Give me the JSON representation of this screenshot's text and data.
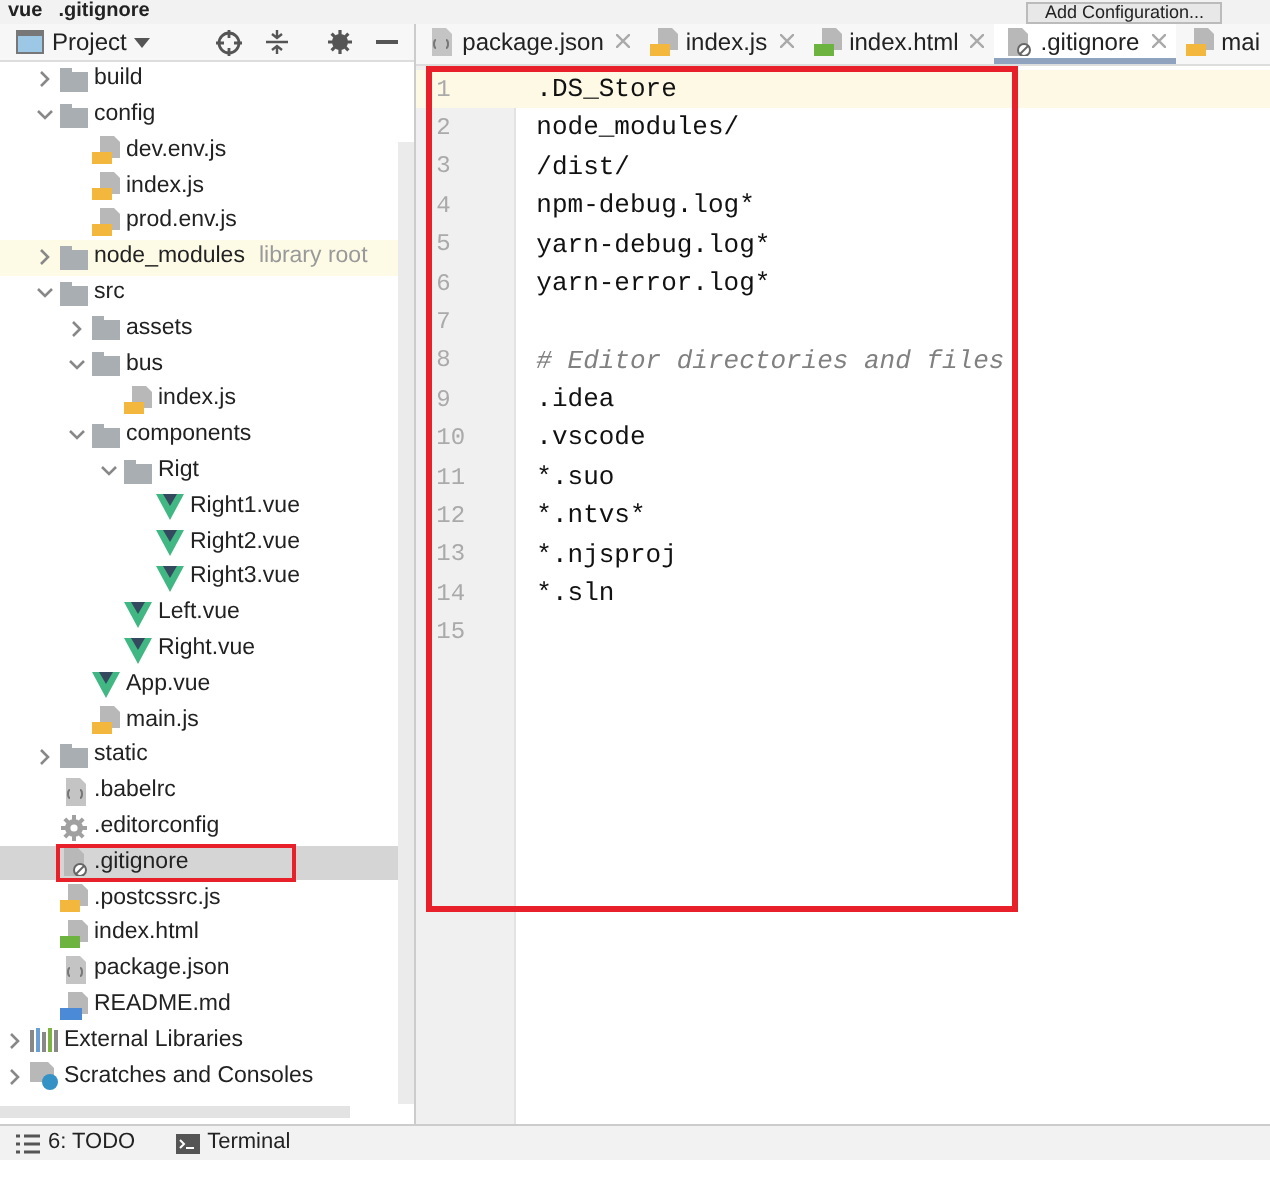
{
  "breadcrumb": [
    "vue",
    ".gitignore"
  ],
  "run_config": {
    "label": "Add Configuration..."
  },
  "project_panel": {
    "title": "Project"
  },
  "tree": [
    {
      "name": "build",
      "kind": "folder",
      "expanded": false,
      "selected": false,
      "highlighted": false
    },
    {
      "name": "config",
      "kind": "folder",
      "expanded": true,
      "selected": false,
      "highlighted": false,
      "children": [
        {
          "name": "dev.env.js",
          "kind": "js",
          "selected": false,
          "highlighted": false
        },
        {
          "name": "index.js",
          "kind": "js",
          "selected": false,
          "highlighted": false
        },
        {
          "name": "prod.env.js",
          "kind": "js",
          "selected": false,
          "highlighted": false
        }
      ]
    },
    {
      "name": "node_modules",
      "kind": "folder",
      "expanded": false,
      "selected": false,
      "highlighted": false,
      "hint": "library root"
    },
    {
      "name": "src",
      "kind": "folder",
      "expanded": true,
      "selected": false,
      "highlighted": false,
      "children": [
        {
          "name": "assets",
          "kind": "folder",
          "expanded": false,
          "selected": false,
          "highlighted": false
        },
        {
          "name": "bus",
          "kind": "folder",
          "expanded": true,
          "selected": false,
          "highlighted": false,
          "children": [
            {
              "name": "index.js",
              "kind": "js",
              "selected": false,
              "highlighted": false
            }
          ]
        },
        {
          "name": "components",
          "kind": "folder",
          "expanded": true,
          "selected": false,
          "highlighted": false,
          "children": [
            {
              "name": "Rigt",
              "kind": "folder",
              "expanded": true,
              "selected": false,
              "highlighted": false,
              "children": [
                {
                  "name": "Right1.vue",
                  "kind": "vue",
                  "selected": false,
                  "highlighted": false
                },
                {
                  "name": "Right2.vue",
                  "kind": "vue",
                  "selected": false,
                  "highlighted": false
                },
                {
                  "name": "Right3.vue",
                  "kind": "vue",
                  "selected": false,
                  "highlighted": false
                }
              ]
            },
            {
              "name": "Left.vue",
              "kind": "vue",
              "selected": false,
              "highlighted": false
            },
            {
              "name": "Right.vue",
              "kind": "vue",
              "selected": false,
              "highlighted": false
            }
          ]
        },
        {
          "name": "App.vue",
          "kind": "vue",
          "selected": false,
          "highlighted": false
        },
        {
          "name": "main.js",
          "kind": "js",
          "selected": false,
          "highlighted": false
        }
      ]
    },
    {
      "name": "static",
      "kind": "folder",
      "expanded": false,
      "selected": false,
      "highlighted": false
    },
    {
      "name": ".babelrc",
      "kind": "config",
      "selected": false,
      "highlighted": false
    },
    {
      "name": ".editorconfig",
      "kind": "settings",
      "selected": false,
      "highlighted": false
    },
    {
      "name": ".gitignore",
      "kind": "ignore",
      "selected": true,
      "highlighted": true
    },
    {
      "name": ".postcssrc.js",
      "kind": "js",
      "selected": false,
      "highlighted": false
    },
    {
      "name": "index.html",
      "kind": "html",
      "selected": false,
      "highlighted": false
    },
    {
      "name": "package.json",
      "kind": "config",
      "selected": false,
      "highlighted": false
    },
    {
      "name": "README.md",
      "kind": "md",
      "selected": false,
      "highlighted": false
    },
    {
      "name": "External Libraries",
      "kind": "libraries",
      "expanded": false,
      "selected": false,
      "highlighted": false
    },
    {
      "name": "Scratches and Consoles",
      "kind": "scratches",
      "expanded": false,
      "selected": false,
      "highlighted": false
    }
  ],
  "tabs": [
    {
      "label": "package.json",
      "kind": "config",
      "selected": false,
      "closable": true
    },
    {
      "label": "index.js",
      "kind": "js",
      "selected": false,
      "closable": true
    },
    {
      "label": "index.html",
      "kind": "html",
      "selected": false,
      "closable": true
    },
    {
      "label": ".gitignore",
      "kind": "ignore",
      "selected": true,
      "closable": true
    },
    {
      "label": "mai",
      "kind": "js",
      "selected": false,
      "closable": false
    }
  ],
  "editor": {
    "highlighted": true,
    "lines": [
      {
        "number": "1",
        "text": ".DS_Store",
        "kind": "code",
        "current": true
      },
      {
        "number": "2",
        "text": "node_modules/",
        "kind": "code",
        "current": false
      },
      {
        "number": "3",
        "text": "/dist/",
        "kind": "code",
        "current": false
      },
      {
        "number": "4",
        "text": "npm-debug.log*",
        "kind": "code",
        "current": false
      },
      {
        "number": "5",
        "text": "yarn-debug.log*",
        "kind": "code",
        "current": false
      },
      {
        "number": "6",
        "text": "yarn-error.log*",
        "kind": "code",
        "current": false
      },
      {
        "number": "7",
        "kind": "blank",
        "current": false
      },
      {
        "number": "8",
        "text": "# Editor directories and files",
        "kind": "comment",
        "current": false
      },
      {
        "number": "9",
        "text": ".idea",
        "kind": "code",
        "current": false
      },
      {
        "number": "10",
        "text": ".vscode",
        "kind": "code",
        "current": false
      },
      {
        "number": "11",
        "text": "*.suo",
        "kind": "code",
        "current": false
      },
      {
        "number": "12",
        "text": "*.ntvs*",
        "kind": "code",
        "current": false
      },
      {
        "number": "13",
        "text": "*.njsproj",
        "kind": "code",
        "current": false
      },
      {
        "number": "14",
        "text": "*.sln",
        "kind": "code",
        "current": false
      },
      {
        "number": "15",
        "kind": "blank",
        "current": false
      }
    ]
  },
  "tool_windows": [
    {
      "label": "6: TODO",
      "kind": "todo"
    },
    {
      "label": "Terminal",
      "kind": "terminal"
    }
  ]
}
